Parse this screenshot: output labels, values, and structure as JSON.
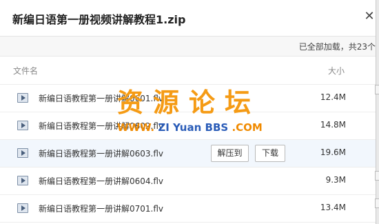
{
  "dialog": {
    "title": "新编日语第一册视频讲解教程1.zip",
    "close_icon": "close-icon",
    "status": "已全部加载，共23个"
  },
  "columns": {
    "name": "文件名",
    "size": "大小"
  },
  "files": [
    {
      "name": "新编日语教程第一册讲解0601.flv",
      "size": "12.4M"
    },
    {
      "name": "新编日语教程第一册讲解0602.flv",
      "size": "14.8M"
    },
    {
      "name": "新编日语教程第一册讲解0603.flv",
      "size": "19.6M"
    },
    {
      "name": "新编日语教程第一册讲解0604.flv",
      "size": "9.3M"
    },
    {
      "name": "新编日语教程第一册讲解0701.flv",
      "size": "13.4M"
    }
  ],
  "row_actions": {
    "extract": "解压到",
    "download": "下载"
  },
  "watermark": {
    "main": "资源论坛",
    "sub_prefix": "WWW.",
    "sub_middle": "ZI Yuan",
    "sub_bbs": "BBS",
    "sub_suffix": ".COM"
  },
  "colors": {
    "watermark_orange": "#f59b15",
    "watermark_blue": "#2a5cb8"
  }
}
